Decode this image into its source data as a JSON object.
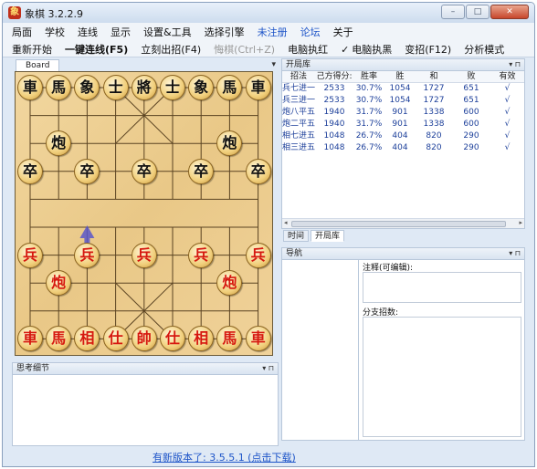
{
  "window": {
    "title": "象棋 3.2.2.9",
    "app_icon": "象",
    "controls": {
      "minimize": "–",
      "maximize": "□",
      "close": "✕"
    }
  },
  "menu": [
    {
      "label": "局面",
      "highlight": false
    },
    {
      "label": "学校",
      "highlight": false
    },
    {
      "label": "连线",
      "highlight": false
    },
    {
      "label": "显示",
      "highlight": false
    },
    {
      "label": "设置&工具",
      "highlight": false
    },
    {
      "label": "选择引擎",
      "highlight": false
    },
    {
      "label": "未注册",
      "highlight": true
    },
    {
      "label": "论坛",
      "highlight": true
    },
    {
      "label": "关于",
      "highlight": false
    }
  ],
  "toolbar": {
    "restart": "重新开始",
    "one_click_link": "一键连线(F5)",
    "move_now": "立刻出招(F4)",
    "undo": "悔棋(Ctrl+Z)",
    "computer_red": "电脑执红",
    "computer_black_check": "✓",
    "computer_black": "电脑执黑",
    "change_move": "变招(F12)",
    "analysis": "分析模式"
  },
  "board_panel": {
    "tab": "Board",
    "pin": "▾",
    "pieces": [
      {
        "ch": "車",
        "side": "black",
        "file": 0,
        "rank": 0
      },
      {
        "ch": "馬",
        "side": "black",
        "file": 1,
        "rank": 0
      },
      {
        "ch": "象",
        "side": "black",
        "file": 2,
        "rank": 0
      },
      {
        "ch": "士",
        "side": "black",
        "file": 3,
        "rank": 0
      },
      {
        "ch": "將",
        "side": "black",
        "file": 4,
        "rank": 0
      },
      {
        "ch": "士",
        "side": "black",
        "file": 5,
        "rank": 0
      },
      {
        "ch": "象",
        "side": "black",
        "file": 6,
        "rank": 0
      },
      {
        "ch": "馬",
        "side": "black",
        "file": 7,
        "rank": 0
      },
      {
        "ch": "車",
        "side": "black",
        "file": 8,
        "rank": 0
      },
      {
        "ch": "炮",
        "side": "black",
        "file": 1,
        "rank": 2
      },
      {
        "ch": "炮",
        "side": "black",
        "file": 7,
        "rank": 2
      },
      {
        "ch": "卒",
        "side": "black",
        "file": 0,
        "rank": 3
      },
      {
        "ch": "卒",
        "side": "black",
        "file": 2,
        "rank": 3
      },
      {
        "ch": "卒",
        "side": "black",
        "file": 4,
        "rank": 3
      },
      {
        "ch": "卒",
        "side": "black",
        "file": 6,
        "rank": 3
      },
      {
        "ch": "卒",
        "side": "black",
        "file": 8,
        "rank": 3
      },
      {
        "ch": "兵",
        "side": "red",
        "file": 0,
        "rank": 6
      },
      {
        "ch": "兵",
        "side": "red",
        "file": 2,
        "rank": 6
      },
      {
        "ch": "兵",
        "side": "red",
        "file": 4,
        "rank": 6
      },
      {
        "ch": "兵",
        "side": "red",
        "file": 6,
        "rank": 6
      },
      {
        "ch": "兵",
        "side": "red",
        "file": 8,
        "rank": 6
      },
      {
        "ch": "炮",
        "side": "red",
        "file": 1,
        "rank": 7
      },
      {
        "ch": "炮",
        "side": "red",
        "file": 7,
        "rank": 7
      },
      {
        "ch": "車",
        "side": "red",
        "file": 0,
        "rank": 9
      },
      {
        "ch": "馬",
        "side": "red",
        "file": 1,
        "rank": 9
      },
      {
        "ch": "相",
        "side": "red",
        "file": 2,
        "rank": 9
      },
      {
        "ch": "仕",
        "side": "red",
        "file": 3,
        "rank": 9
      },
      {
        "ch": "帥",
        "side": "red",
        "file": 4,
        "rank": 9
      },
      {
        "ch": "仕",
        "side": "red",
        "file": 5,
        "rank": 9
      },
      {
        "ch": "相",
        "side": "red",
        "file": 6,
        "rank": 9
      },
      {
        "ch": "馬",
        "side": "red",
        "file": 7,
        "rank": 9
      },
      {
        "ch": "車",
        "side": "red",
        "file": 8,
        "rank": 9
      }
    ],
    "arrow": {
      "file": 2,
      "rank": 5
    }
  },
  "think_panel": {
    "title": "思考细节",
    "controls": "▾ ⊓"
  },
  "status": {
    "update_text": "有新版本了: 3.5.5.1 (点击下载)"
  },
  "opening_panel": {
    "title": "开局库",
    "controls": "▾ ⊓",
    "columns": [
      "招法",
      "己方得分:",
      "胜率",
      "胜",
      "和",
      "败",
      "有效"
    ],
    "rows": [
      [
        "兵七进一",
        "2533",
        "30.7%",
        "1054",
        "1727",
        "651",
        "√"
      ],
      [
        "兵三进一",
        "2533",
        "30.7%",
        "1054",
        "1727",
        "651",
        "√"
      ],
      [
        "炮八平五",
        "1940",
        "31.7%",
        "901",
        "1338",
        "600",
        "√"
      ],
      [
        "炮二平五",
        "1940",
        "31.7%",
        "901",
        "1338",
        "600",
        "√"
      ],
      [
        "相七进五",
        "1048",
        "26.7%",
        "404",
        "820",
        "290",
        "√"
      ],
      [
        "相三进五",
        "1048",
        "26.7%",
        "404",
        "820",
        "290",
        "√"
      ]
    ]
  },
  "tabs": [
    {
      "label": "时间",
      "active": false
    },
    {
      "label": "开局库",
      "active": true
    }
  ],
  "nav_panel": {
    "title": "导航",
    "controls": "▾ ⊓",
    "note_label": "注释(可编辑):",
    "branch_label": "分支招数:"
  }
}
